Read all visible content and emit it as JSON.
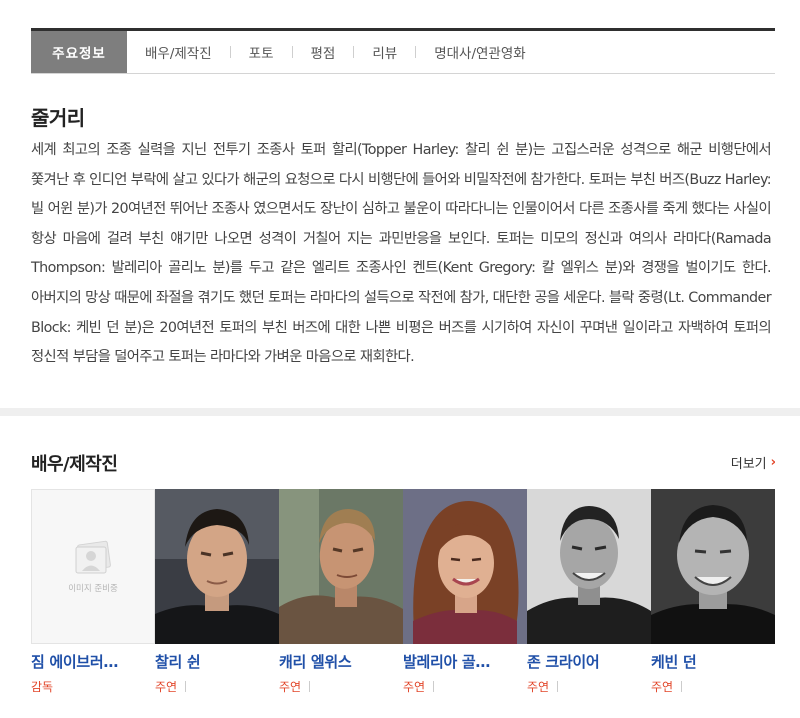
{
  "tabs": [
    {
      "label": "주요정보",
      "active": true
    },
    {
      "label": "배우/제작진",
      "active": false
    },
    {
      "label": "포토",
      "active": false
    },
    {
      "label": "평점",
      "active": false
    },
    {
      "label": "리뷰",
      "active": false
    },
    {
      "label": "명대사/연관영화",
      "active": false
    }
  ],
  "synopsis": {
    "title": "줄거리",
    "text": "세계 최고의 조종 실력을 지닌 전투기 조종사 토퍼 할리(Topper Harley: 찰리 쉰 분)는 고집스러운 성격으로 해군 비행단에서 쫓겨난 후 인디언 부락에 살고 있다가 해군의 요청으로 다시 비행단에 들어와 비밀작전에 참가한다. 토퍼는 부친 버즈(Buzz Harley: 빌 어윈 분)가 20여년전 뛰어난 조종사 였으면서도 장난이 심하고 불운이 따라다니는 인물이어서 다른 조종사를 죽게 했다는 사실이 항상 마음에 걸려 부친 얘기만 나오면 성격이 거칠어 지는 과민반응을 보인다. 토퍼는 미모의 정신과 여의사 라마다(Ramada Thompson: 발레리아 골리노 분)를 두고 같은 엘리트 조종사인 켄트(Kent Gregory: 칼 엘위스 분)와 경쟁을 벌이기도 한다. 아버지의 망상 때문에 좌절을 겪기도 했던 토퍼는 라마다의 설득으로 작전에 참가, 대단한 공을 세운다. 블락 중령(Lt. Commander Block: 케빈 던 분)은 20여년전 토퍼의 부친 버즈에 대한 나쁜 비평은 버즈를 시기하여 자신이 꾸며낸 일이라고 자백하여 토퍼의 정신적 부담을 덜어주고 토퍼는 라마다와 가벼운 마음으로 재회한다."
  },
  "cast": {
    "title": "배우/제작진",
    "more_label": "더보기",
    "more_icon": "chevron-right-icon",
    "no_photo_label": "이미지 준비중",
    "members": [
      {
        "name": "짐 에이브러…",
        "role": "감독",
        "photo": false
      },
      {
        "name": "찰리 쉰",
        "role": "주연",
        "photo": true
      },
      {
        "name": "캐리 엘위스",
        "role": "주연",
        "photo": true
      },
      {
        "name": "발레리아 골…",
        "role": "주연",
        "photo": true
      },
      {
        "name": "존 크라이어",
        "role": "주연",
        "photo": true
      },
      {
        "name": "케빈 던",
        "role": "주연",
        "photo": true
      }
    ]
  },
  "colors": {
    "accent": "#e2462a",
    "name_link": "#2050a8",
    "tab_active_bg": "#7e7e7e"
  }
}
